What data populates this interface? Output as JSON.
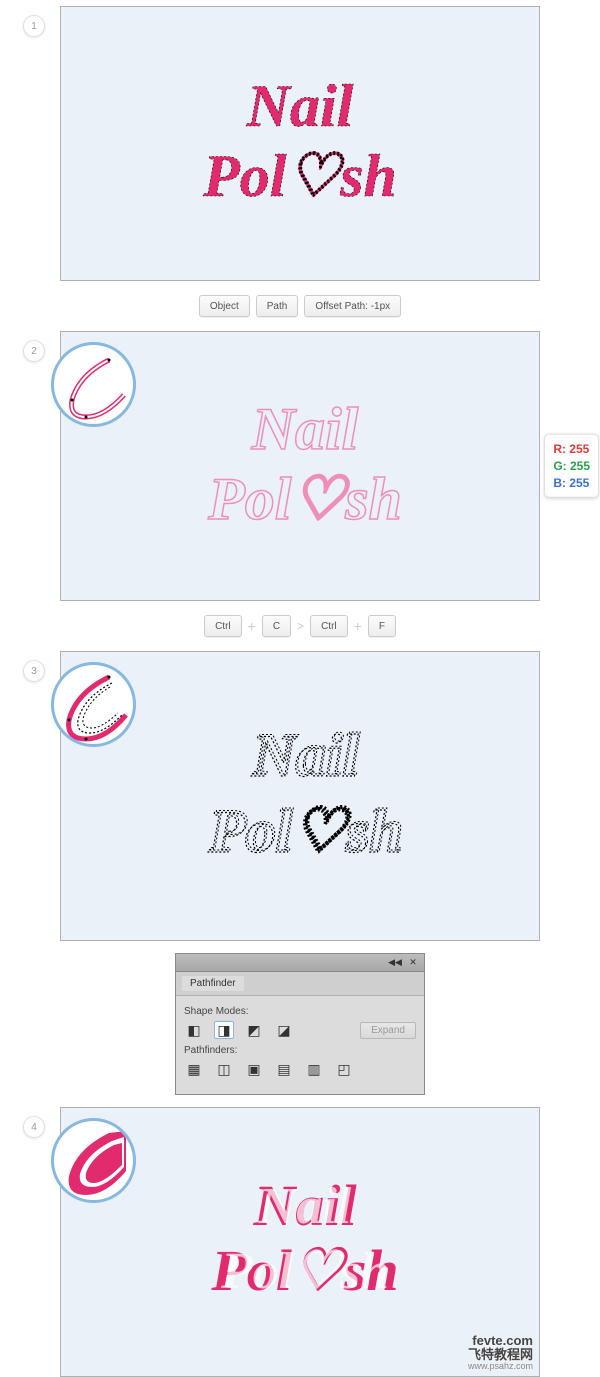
{
  "steps": {
    "s1": {
      "num": "1",
      "text_line1": "Nail",
      "text_line2": "Pol♡sh"
    },
    "s2": {
      "num": "2",
      "text_line1": "Nail",
      "text_line2": "Pol♡sh"
    },
    "s3": {
      "num": "3",
      "text_line1": "Nail",
      "text_line2": "Pol♡sh"
    },
    "s4": {
      "num": "4",
      "text_line1": "Nail",
      "text_line2": "Pol♡sh"
    }
  },
  "actions1": {
    "object_label": "Object",
    "path_label": "Path",
    "offset_label": "Offset Path: -1px"
  },
  "rgb": {
    "r": "R: 255",
    "g": "G: 255",
    "b": "B: 255"
  },
  "keys": {
    "ctrl1": "Ctrl",
    "plus1": "+",
    "c": "C",
    "arrow": ">",
    "ctrl2": "Ctrl",
    "plus2": "+",
    "f": "F"
  },
  "pathfinder": {
    "tab": "Pathfinder",
    "shape_modes": "Shape Modes:",
    "pathfinders": "Pathfinders:",
    "expand": "Expand"
  },
  "watermark": {
    "line1": "fevte.com",
    "line2": "飞特教程网",
    "line3": "www.psahz.com"
  }
}
